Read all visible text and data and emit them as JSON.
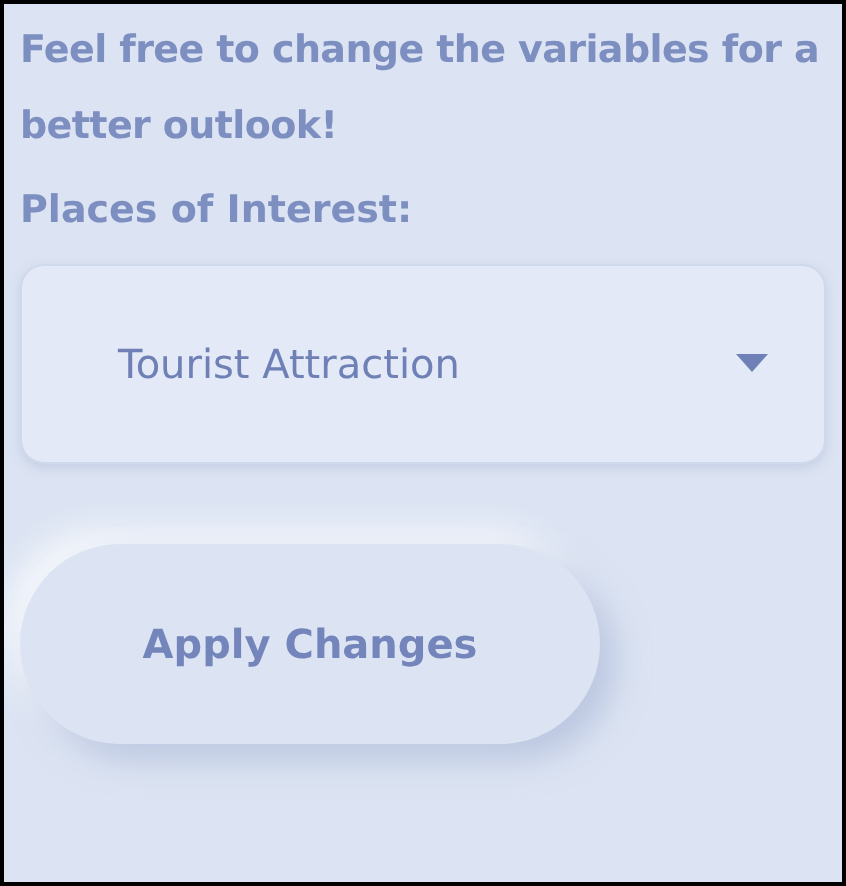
{
  "intro": "Feel free to change the variables for a better outlook!",
  "places_label": "Places of Interest:",
  "dropdown": {
    "value": "Tourist Attraction",
    "expanded": false
  },
  "apply_button": "Apply Changes"
}
